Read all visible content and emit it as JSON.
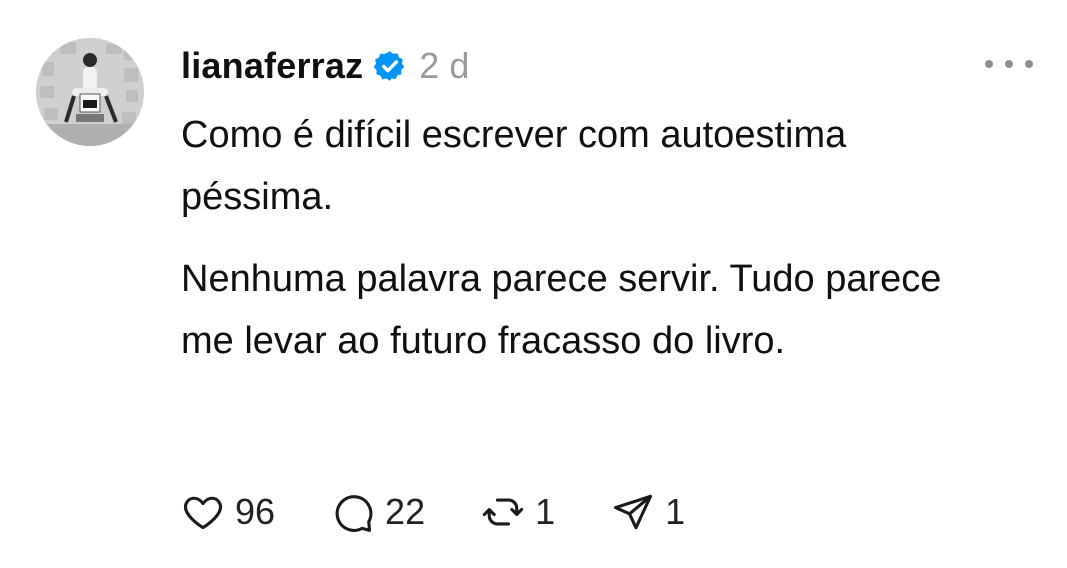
{
  "post": {
    "username": "lianaferraz",
    "timestamp": "2 d",
    "paragraphs": [
      "Como é difícil escrever com autoestima péssima.",
      "Nenhuma palavra parece servir. Tudo parece me levar ao futuro fracasso do livro."
    ],
    "actions": {
      "likes": "96",
      "replies": "22",
      "reposts": "1",
      "shares": "1"
    }
  },
  "icons": {
    "verified": "verified-badge-icon",
    "more": "more-options-icon",
    "like": "heart-icon",
    "reply": "comment-bubble-icon",
    "repost": "repost-icon",
    "share": "send-icon"
  },
  "colors": {
    "verified": "#0095f6",
    "text": "#101010",
    "muted": "#9a9a9a"
  }
}
